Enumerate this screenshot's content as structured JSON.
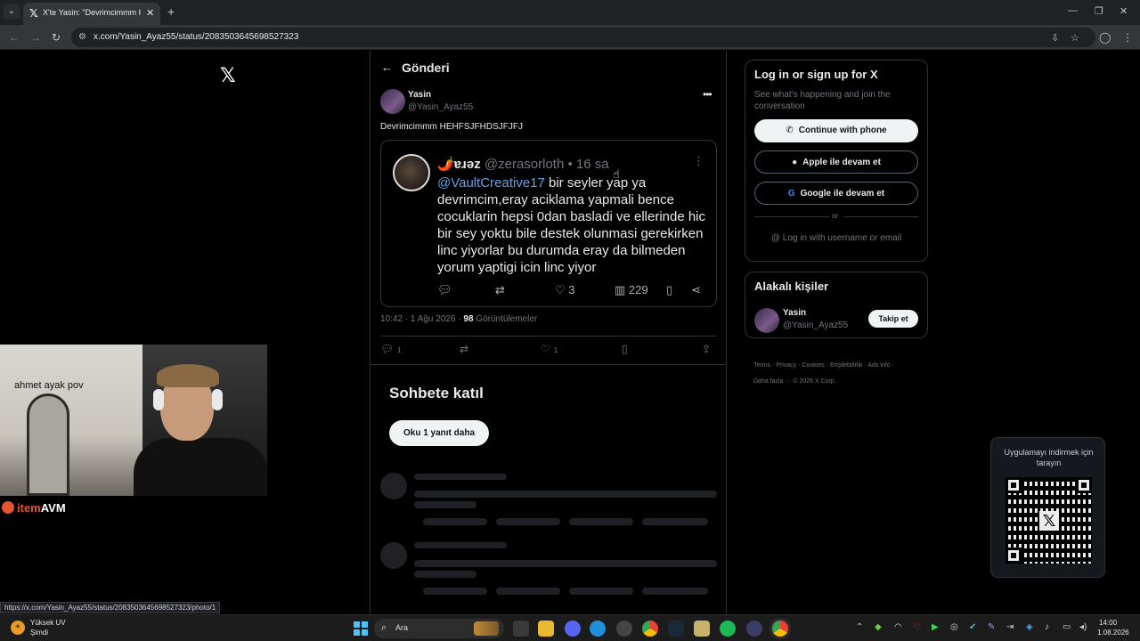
{
  "browser": {
    "tab_title": "X'te Yasin: \"Devrimcimmm HEH",
    "url": "x.com/Yasin_Ayaz55/status/2083503645698527323",
    "status_url": "https://x.com/Yasin_Ayaz55/status/2083503645698527323/photo/1"
  },
  "header": {
    "title": "Gönderi"
  },
  "post": {
    "author_name": "Yasin",
    "author_handle": "@Yasin_Ayaz55",
    "text": "Devrimcimmm HEHFSJFHDSJFJFJ",
    "embedded": {
      "name": "🌶️ɐɹəz",
      "handle_time": "@zerasorloth • 16 sa",
      "mention": "@VaultCreative17",
      "body": " bir seyler yap ya devrimcim,eray aciklama yapmali bence cocuklarin hepsi 0dan basladi ve ellerinde hic bir sey yoktu bile destek olunmasi gerekirken linc yiyorlar bu durumda eray da bilmeden yorum yaptigi icin linc yiyor",
      "likes": "3",
      "views": "229"
    },
    "timestamp": "10:42 · 1 Ağu 2026 ·",
    "views_count": "98",
    "views_label": "Görüntülemeler",
    "reply_count": "1",
    "like_count": "1"
  },
  "conversation": {
    "title": "Sohbete katıl",
    "more_replies": "Oku 1 yanıt daha"
  },
  "login": {
    "title": "Log in or sign up for X",
    "subtitle": "See what's happening and join the conversation",
    "phone": "Continue with phone",
    "apple": "Apple ile devam et",
    "google": "Google ile devam et",
    "or": "or",
    "username": "Log in with username or email"
  },
  "related": {
    "title": "Alakalı kişiler",
    "name": "Yasin",
    "handle": "@Yasin_Ayaz55",
    "follow": "Takip et"
  },
  "footer": {
    "line1": "Terms · Privacy · Cookies · Erişilebilirlik · Ads info ·",
    "line2": "Daha fazla ··· © 2026 X Corp."
  },
  "qr": {
    "text": "Uygulamayı indirmek için tarayın"
  },
  "overlay": {
    "webcam_text": "ahmet ayak pov",
    "brand_a": "item",
    "brand_b": "AVM"
  },
  "taskbar": {
    "weather_title": "Yüksek UV",
    "weather_sub": "Şimdi",
    "search": "Ara",
    "time": "14:00",
    "date": "1.08.2026"
  }
}
